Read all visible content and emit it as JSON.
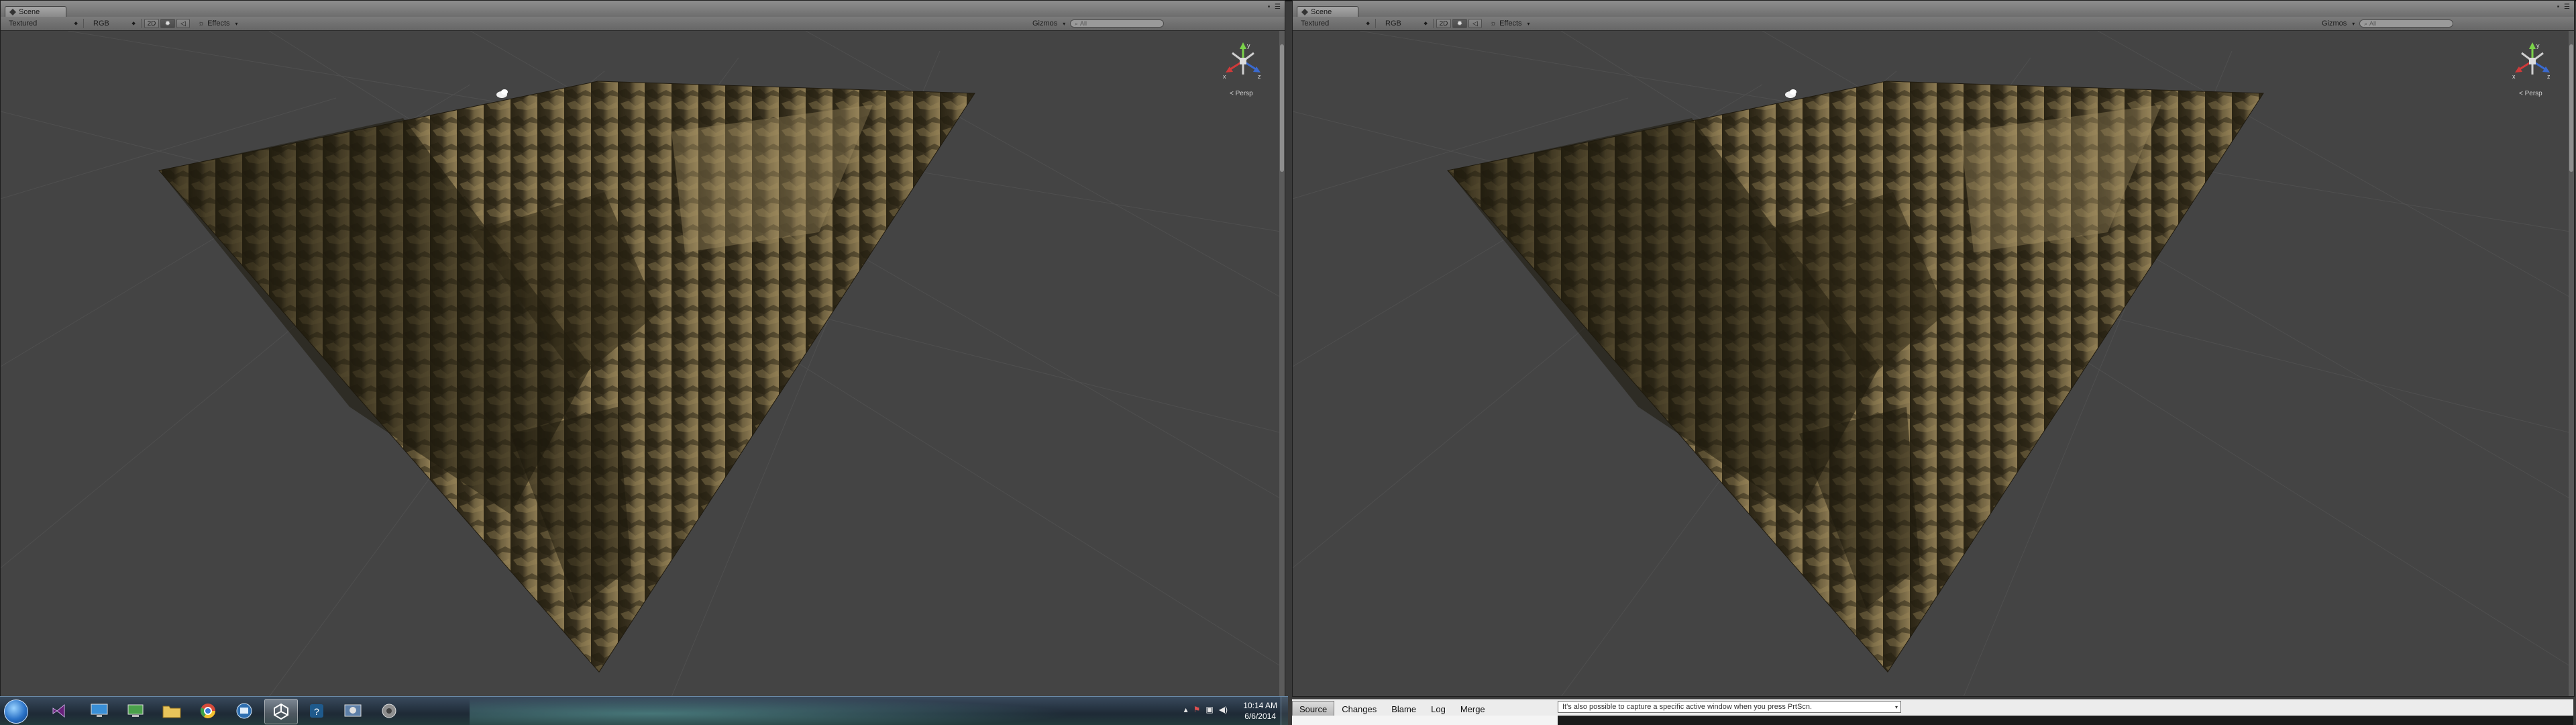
{
  "scene": {
    "tab_label": "Scene",
    "shading_mode": "Textured",
    "render_mode": "RGB",
    "mode_2d": "2D",
    "effects_label": "Effects",
    "gizmos_label": "Gizmos",
    "search_placeholder": "All",
    "persp_label": "< Persp",
    "gizmo_axes": {
      "y": "y",
      "x": "x",
      "z": "z"
    }
  },
  "taskbar": {
    "apps": [
      {
        "name": "start-orb"
      },
      {
        "name": "visual-studio-icon"
      },
      {
        "name": "remote-desktop-icon"
      },
      {
        "name": "network-icon"
      },
      {
        "name": "explorer-icon"
      },
      {
        "name": "chrome-icon"
      },
      {
        "name": "monitor-app-icon"
      },
      {
        "name": "unity-icon"
      },
      {
        "name": "perforce-icon"
      },
      {
        "name": "tool-icon"
      },
      {
        "name": "settings-icon"
      }
    ],
    "clock_time": "10:14 AM",
    "clock_date": "6/6/2014"
  },
  "bottom_panel": {
    "tabs": [
      "Source",
      "Changes",
      "Blame",
      "Log",
      "Merge"
    ],
    "active_tab": "Source",
    "message": "It's also possible to capture a specific active window when you press PrtScn."
  },
  "colors": {
    "viewport_bg": "#444444",
    "terrain_dark": "#2a2414",
    "terrain_light": "#8c7a52",
    "gizmo_y": "#7bd24a",
    "gizmo_x": "#d03a3a",
    "gizmo_z": "#3a6ad0"
  }
}
